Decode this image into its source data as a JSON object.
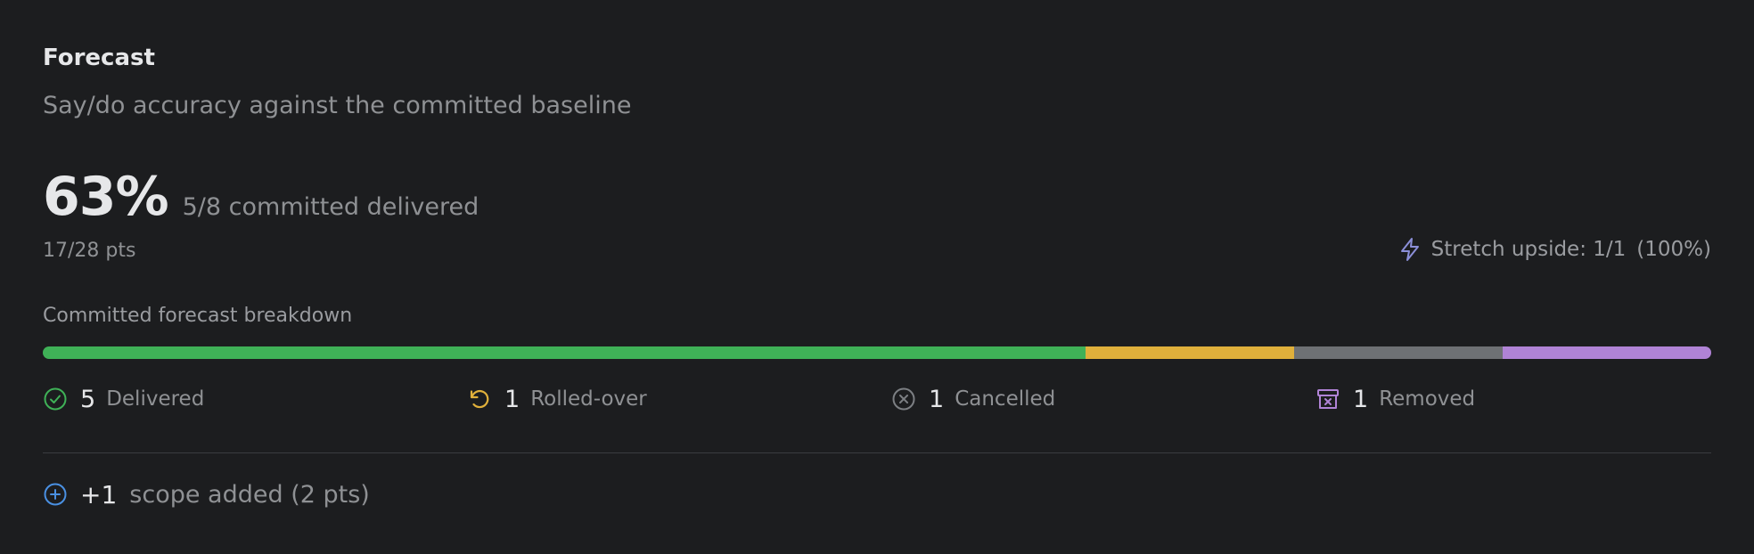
{
  "card": {
    "title": "Forecast",
    "subtitle": "Say/do accuracy against the committed baseline"
  },
  "summary": {
    "percent": "63%",
    "committed_text": "5/8 committed delivered",
    "points_text": "17/28 pts"
  },
  "stretch": {
    "icon": "lightning-icon",
    "label": "Stretch upside: 1/1",
    "percent": "(100%)",
    "color": "#8b8fd8"
  },
  "breakdown": {
    "label": "Committed forecast breakdown",
    "segments": [
      {
        "name": "Delivered",
        "count": 5,
        "color": "#3fb157",
        "icon": "check-circle-icon"
      },
      {
        "name": "Rolled-over",
        "count": 1,
        "color": "#e0b03b",
        "icon": "rotate-icon"
      },
      {
        "name": "Cancelled",
        "count": 1,
        "color": "#6e7174",
        "icon": "x-circle-icon"
      },
      {
        "name": "Removed",
        "count": 1,
        "color": "#b083d6",
        "icon": "archive-x-icon"
      }
    ]
  },
  "scope": {
    "count": "+1",
    "label": "scope added (2 pts)",
    "icon": "plus-circle-icon",
    "color": "#4a90e2"
  }
}
